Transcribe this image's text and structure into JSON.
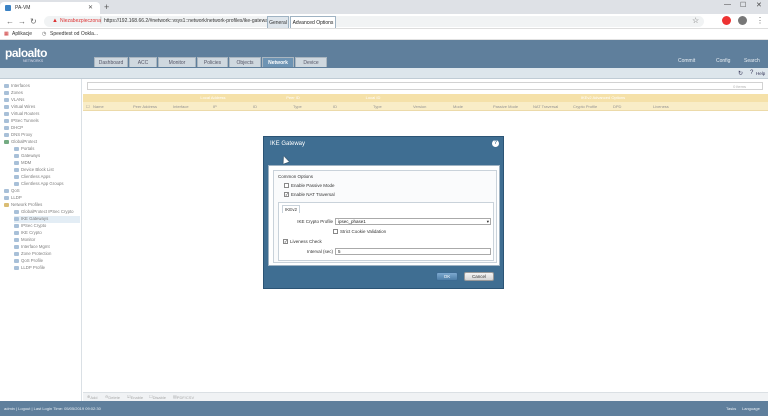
{
  "browser": {
    "tab_title": "PA-VM",
    "new_tab": "+",
    "not_secure": "Niezabezpieczona",
    "url": "https://192.168.66.2/#network::vsys1::network/network-profiles/ike-gateways",
    "bookmarks": [
      "Aplikacje",
      "Speedtest od Ookla..."
    ]
  },
  "app": {
    "logo": "paloalto",
    "logo_sub": "NETWORKS",
    "tabs": [
      "Dashboard",
      "ACC",
      "Monitor",
      "Policies",
      "Objects",
      "Network",
      "Device"
    ],
    "active_tab": "Network",
    "header_links": [
      "Commit",
      "Config",
      "Search"
    ],
    "help": "Help"
  },
  "sidebar": {
    "items": [
      {
        "label": "Interfaces"
      },
      {
        "label": "Zones"
      },
      {
        "label": "VLANs"
      },
      {
        "label": "Virtual Wires"
      },
      {
        "label": "Virtual Routers"
      },
      {
        "label": "IPSec Tunnels"
      },
      {
        "label": "DHCP"
      },
      {
        "label": "DNS Proxy"
      },
      {
        "label": "GlobalProtect"
      },
      {
        "label": "Portals"
      },
      {
        "label": "Gateways"
      },
      {
        "label": "MDM"
      },
      {
        "label": "Device Block List"
      },
      {
        "label": "Clientless Apps"
      },
      {
        "label": "Clientless App Groups"
      },
      {
        "label": "QoS"
      },
      {
        "label": "LLDP"
      },
      {
        "label": "Network Profiles"
      },
      {
        "label": "GlobalProtect IPSec Crypto"
      },
      {
        "label": "IKE Gateways"
      },
      {
        "label": "IPSec Crypto"
      },
      {
        "label": "IKE Crypto"
      },
      {
        "label": "Monitor"
      },
      {
        "label": "Interface Mgmt"
      },
      {
        "label": "Zone Protection"
      },
      {
        "label": "QoS Profile"
      },
      {
        "label": "LLDP Profile"
      }
    ]
  },
  "table": {
    "count": "0 items",
    "group_headers": [
      "Local Address",
      "Peer ID",
      "Local ID",
      "IKEv2 Advanced Options"
    ],
    "columns": [
      "Name",
      "Peer Address",
      "Interface",
      "IP",
      "ID",
      "Type",
      "ID",
      "Type",
      "Version",
      "Mode",
      "Passive Mode",
      "NAT Traversal",
      "Crypto Profile",
      "DPD",
      "Liveness"
    ]
  },
  "footer": {
    "actions": [
      "Add",
      "Delete",
      "Enable",
      "Disable",
      "PDF/CSV"
    ]
  },
  "status": {
    "left": "admin | Logout | Last Login Time: 05/05/2019 09:02:30",
    "right": [
      "Tasks",
      "Language"
    ]
  },
  "dialog": {
    "title": "IKE Gateway",
    "tabs": [
      "General",
      "Advanced Options"
    ],
    "common_options": "Common Options",
    "enable_passive_mode": "Enable Passive Mode",
    "enable_passive_mode_checked": false,
    "enable_nat_traversal": "Enable NAT Traversal",
    "enable_nat_traversal_checked": true,
    "ikev2_tab": "IKEv2",
    "ike_crypto_profile_label": "IKE Crypto Profile",
    "ike_crypto_profile_value": "ipsec_phase1",
    "strict_cookie_validation": "Strict Cookie Validation",
    "strict_cookie_validation_checked": false,
    "liveness_check": "Liveness Check",
    "liveness_check_checked": true,
    "interval_label": "Interval (sec)",
    "interval_value": "5",
    "ok": "OK",
    "cancel": "Cancel"
  },
  "colors": {
    "header_blue": "#5f7f9c",
    "dialog_blue": "#3f6e92",
    "table_header_gold": "#f0d27c"
  }
}
